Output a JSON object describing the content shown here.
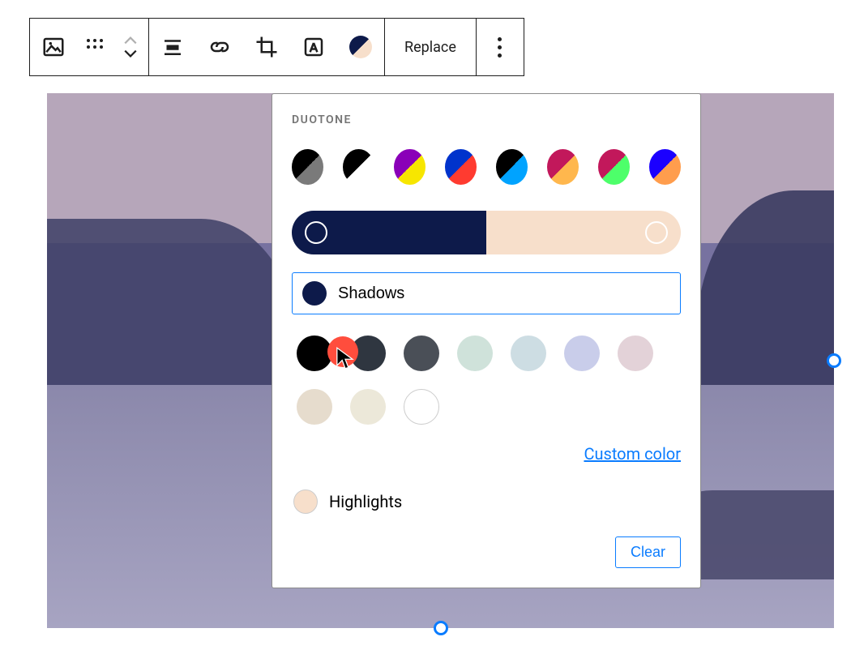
{
  "toolbar": {
    "replace_label": "Replace"
  },
  "popover": {
    "title": "DUOTONE",
    "shadows_label": "Shadows",
    "highlights_label": "Highlights",
    "custom_color_label": "Custom color",
    "clear_label": "Clear",
    "current_shadow": "#0d1a4a",
    "current_highlight": "#f7dfcb",
    "presets": [
      {
        "a": "#000000",
        "b": "#7a7a7a"
      },
      {
        "a": "#000000",
        "b": "#ffffff"
      },
      {
        "a": "#8a00b8",
        "b": "#f7e600"
      },
      {
        "a": "#0033cc",
        "b": "#ff3b30"
      },
      {
        "a": "#000000",
        "b": "#00a3ff"
      },
      {
        "a": "#c2185b",
        "b": "#ffb74d"
      },
      {
        "a": "#c2185b",
        "b": "#4dff6a"
      },
      {
        "a": "#1b00ff",
        "b": "#ff9d4d"
      }
    ],
    "palette": [
      "#000000",
      "#2f3640",
      "#4a4f57",
      "#cfe2da",
      "#cddde3",
      "#c9cdea",
      "#e3d2d8",
      "#e6dccd",
      "#ece8d9",
      "#ffffff"
    ]
  }
}
